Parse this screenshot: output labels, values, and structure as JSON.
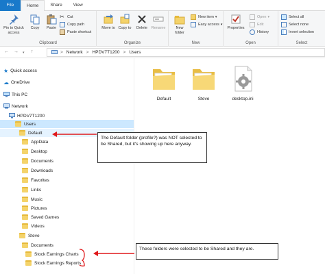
{
  "tabs": [
    {
      "label": "File"
    },
    {
      "label": "Home"
    },
    {
      "label": "Share"
    },
    {
      "label": "View"
    }
  ],
  "ribbon": {
    "clipboard": {
      "pin_label": "Pin to Quick access",
      "copy_label": "Copy",
      "paste_label": "Paste",
      "cut_label": "Cut",
      "copy_path_label": "Copy path",
      "paste_shortcut_label": "Paste shortcut",
      "group_label": "Clipboard"
    },
    "organize": {
      "move_to_label": "Move to",
      "copy_to_label": "Copy to",
      "delete_label": "Delete",
      "rename_label": "Rename",
      "group_label": "Organize"
    },
    "new": {
      "new_folder_label": "New folder",
      "new_item_label": "New item",
      "easy_access_label": "Easy access",
      "group_label": "New"
    },
    "open": {
      "properties_label": "Properties",
      "open_label": "Open",
      "edit_label": "Edit",
      "history_label": "History",
      "group_label": "Open"
    },
    "select": {
      "select_all_label": "Select all",
      "select_none_label": "Select none",
      "invert_label": "Invert selection",
      "group_label": "Select"
    }
  },
  "address": {
    "crumbs": [
      "Network",
      "HPDV7T1200",
      "Users"
    ],
    "sep": ">"
  },
  "tree": {
    "quick_access": "Quick access",
    "onedrive": "OneDrive",
    "this_pc": "This PC",
    "network": "Network",
    "host": "HPDV7T1200",
    "users": "Users",
    "default": "Default",
    "default_children": [
      "AppData",
      "Desktop",
      "Documents",
      "Downloads",
      "Favorites",
      "Links",
      "Music",
      "Pictures",
      "Saved Games",
      "Videos"
    ],
    "steve": "Steve",
    "steve_documents": "Documents",
    "shared_folders": [
      "Stock Earnings Charts",
      "Stock Earnings Reports"
    ]
  },
  "content": {
    "items": [
      {
        "name": "Default",
        "icon": "folder-icon"
      },
      {
        "name": "Steve",
        "icon": "folder-icon"
      },
      {
        "name": "desktop.ini",
        "icon": "settings-file-icon"
      }
    ]
  },
  "annotations": {
    "note1": "The Default folder (profile?) was NOT selected to be Shared, but it's showing up here anyway.",
    "note2": "These folders were selected to be Shared and they are."
  },
  "colors": {
    "file_tab": "#1979ca",
    "selection": "#cce8ff",
    "folder": "#f4d36b",
    "annotation_arrow": "#e0191b"
  }
}
